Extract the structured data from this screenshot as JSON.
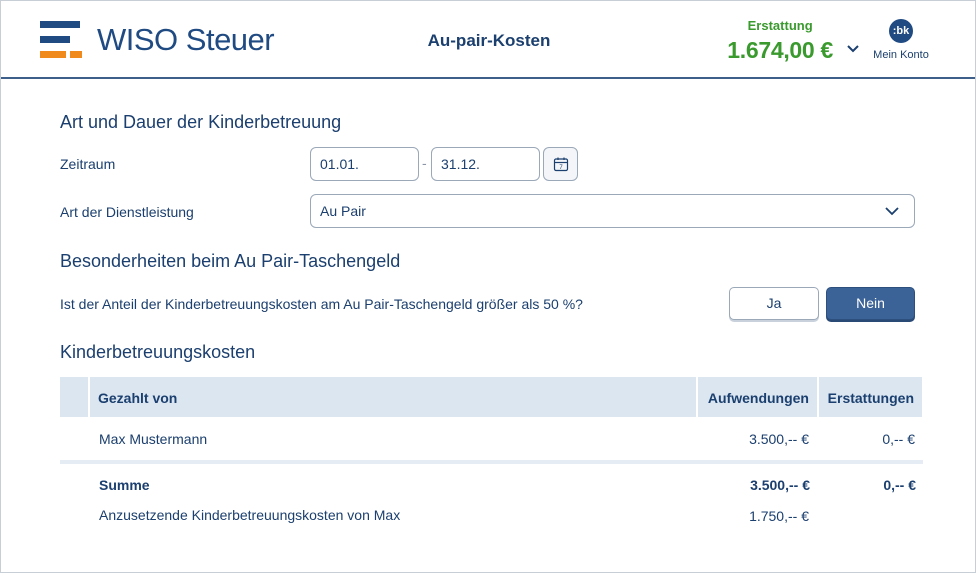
{
  "header": {
    "brand": "WISO Steuer",
    "page_title": "Au-pair-Kosten",
    "refund_label": "Erstattung",
    "refund_amount": "1.674,00 €",
    "account_initials": ":bk",
    "account_label": "Mein Konto"
  },
  "section_care": {
    "heading": "Art und Dauer der Kinderbetreuung",
    "period_label": "Zeitraum",
    "period_from": "01.01.",
    "period_separator": "-",
    "period_to": "31.12.",
    "calendar_day": "7",
    "service_label": "Art der Dienstleistung",
    "service_value": "Au Pair"
  },
  "section_pocket_money": {
    "heading": "Besonderheiten beim Au Pair-Taschengeld",
    "question": "Ist der Anteil der Kinderbetreuungskosten am Au Pair-Taschengeld größer als 50 %?",
    "yes_label": "Ja",
    "no_label": "Nein",
    "selected": "Nein"
  },
  "section_costs": {
    "heading": "Kinderbetreuungskosten",
    "columns": [
      "Gezahlt von",
      "Aufwendungen",
      "Erstattungen"
    ],
    "rows": [
      {
        "name": "Max Mustermann",
        "expenses": "3.500,-- €",
        "refunds": "0,-- €"
      }
    ],
    "sum": {
      "label": "Summe",
      "expenses": "3.500,-- €",
      "refunds": "0,-- €"
    },
    "deductible": {
      "label": "Anzusetzende Kinderbetreuungskosten von Max",
      "expenses": "1.750,-- €"
    }
  },
  "colors": {
    "brand_blue": "#1f4a82",
    "brand_orange": "#f08a1c",
    "refund_green": "#3a9a2e",
    "table_header_bg": "#dbe6f1",
    "primary_button": "#3c6397"
  }
}
